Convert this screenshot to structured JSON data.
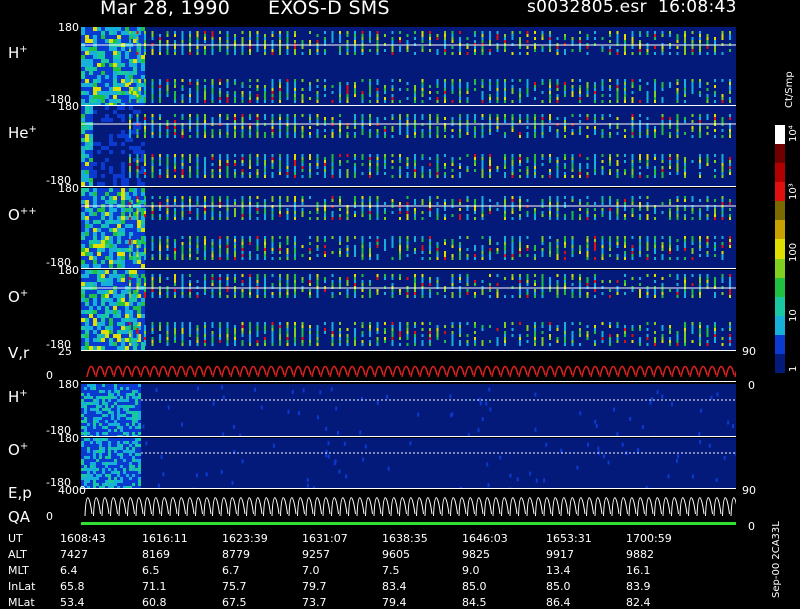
{
  "header": {
    "date": "Mar 28, 1990",
    "mission": "EXOS-D SMS",
    "file": "s0032805.esr",
    "time": "16:08:43"
  },
  "panels": {
    "h_plus": {
      "label": "H",
      "charge": "+",
      "ymax": "180",
      "ymin": "-180"
    },
    "he_plus": {
      "label": "He",
      "charge": "+",
      "ymax": "180",
      "ymin": "-180"
    },
    "o_pp": {
      "label": "O",
      "charge": "++",
      "ymax": "180",
      "ymin": "-180"
    },
    "o_plus": {
      "label": "O",
      "charge": "+",
      "ymax": "180",
      "ymin": "-180"
    },
    "vr": {
      "label": "V,r",
      "ymax": "25",
      "ymin": "0",
      "right": "90",
      "right_low": "0"
    },
    "h_plus2": {
      "label": "H",
      "charge": "+",
      "ymax": "180",
      "ymin": "-180"
    },
    "o_plus2": {
      "label": "O",
      "charge": "+",
      "ymax": "180",
      "ymin": "-180"
    },
    "ep": {
      "label": "E,p",
      "ymax": "4000",
      "ymin": "0",
      "right": "90",
      "right_low": "0"
    },
    "qa": {
      "label": "QA"
    }
  },
  "colorbar": {
    "unit": "Ct/Smp",
    "ticks": [
      "1",
      "10",
      "100",
      "10³",
      "10⁴"
    ],
    "colors": [
      "#041a7a",
      "#0a3ad0",
      "#16b0d8",
      "#19c8a0",
      "#20c040",
      "#80d020",
      "#e0e000",
      "#c8a000",
      "#7a6a00",
      "#e01010",
      "#b00000",
      "#700000",
      "#ffffff"
    ]
  },
  "side_note": "Sep-00 2CA33L",
  "ephemeris": {
    "rows": [
      {
        "label": "UT",
        "values": [
          "1608:43",
          "1616:11",
          "1623:39",
          "1631:07",
          "1638:35",
          "1646:03",
          "1653:31",
          "1700:59"
        ]
      },
      {
        "label": "ALT",
        "values": [
          "7427",
          "8169",
          "8779",
          "9257",
          "9605",
          "9825",
          "9917",
          "9882"
        ]
      },
      {
        "label": "MLT",
        "values": [
          "6.4",
          "6.5",
          "6.7",
          "7.0",
          "7.5",
          "9.0",
          "13.4",
          "16.1"
        ]
      },
      {
        "label": "InLat",
        "values": [
          "65.8",
          "71.1",
          "75.7",
          "79.7",
          "83.4",
          "85.0",
          "85.0",
          "83.9"
        ]
      },
      {
        "label": "MLat",
        "values": [
          "53.4",
          "60.8",
          "67.5",
          "73.7",
          "79.4",
          "84.5",
          "86.4",
          "82.4"
        ]
      }
    ]
  },
  "chart_data": {
    "type": "heatmap",
    "title": "Mar 28, 1990   EXOS-D SMS",
    "x_ticks": [
      "1608:43",
      "1616:11",
      "1623:39",
      "1631:07",
      "1638:35",
      "1646:03",
      "1653:31",
      "1700:59"
    ],
    "series": [
      {
        "name": "H+",
        "ylim": [
          -180,
          180
        ]
      },
      {
        "name": "He+",
        "ylim": [
          -180,
          180
        ]
      },
      {
        "name": "O++",
        "ylim": [
          -180,
          180
        ]
      },
      {
        "name": "O+",
        "ylim": [
          -180,
          180
        ]
      },
      {
        "name": "V,r",
        "ylim": [
          0,
          25
        ]
      },
      {
        "name": "H+",
        "ylim": [
          -180,
          180
        ]
      },
      {
        "name": "O+",
        "ylim": [
          -180,
          180
        ]
      },
      {
        "name": "E,p",
        "ylim": [
          0,
          4000
        ]
      },
      {
        "name": "QA"
      }
    ],
    "colorbar_unit": "Ct/Smp",
    "colorbar_scale": "log",
    "colorbar_range": [
      1,
      10000
    ]
  }
}
